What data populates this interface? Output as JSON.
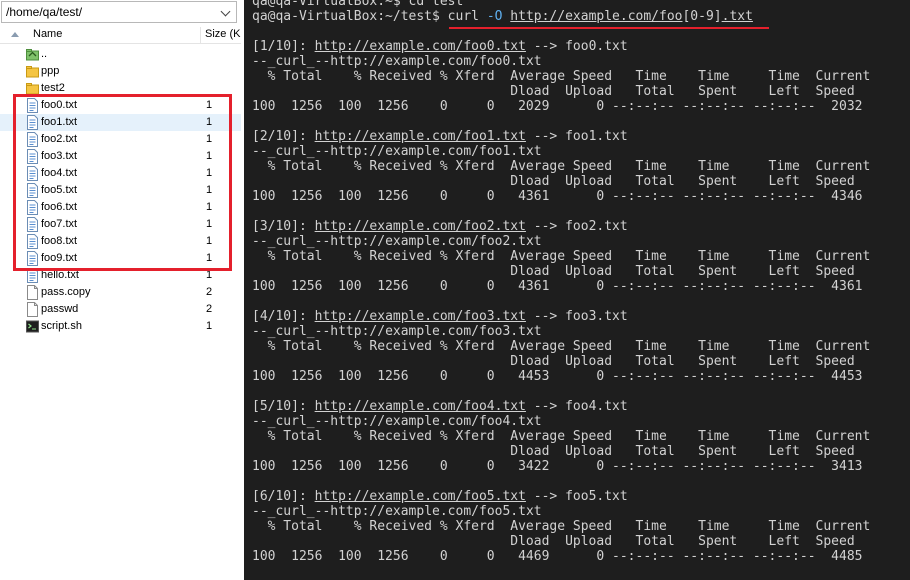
{
  "file_panel": {
    "path": "/home/qa/test/",
    "columns": {
      "name": "Name",
      "size": "Size (K"
    },
    "files": [
      {
        "name": "..",
        "size": "",
        "icon": "folder-up-icon"
      },
      {
        "name": "ppp",
        "size": "",
        "icon": "folder-icon"
      },
      {
        "name": "test2",
        "size": "",
        "icon": "folder-icon"
      },
      {
        "name": "foo0.txt",
        "size": "1",
        "icon": "text-file-icon"
      },
      {
        "name": "foo1.txt",
        "size": "1",
        "icon": "text-file-icon"
      },
      {
        "name": "foo2.txt",
        "size": "1",
        "icon": "text-file-icon"
      },
      {
        "name": "foo3.txt",
        "size": "1",
        "icon": "text-file-icon"
      },
      {
        "name": "foo4.txt",
        "size": "1",
        "icon": "text-file-icon"
      },
      {
        "name": "foo5.txt",
        "size": "1",
        "icon": "text-file-icon"
      },
      {
        "name": "foo6.txt",
        "size": "1",
        "icon": "text-file-icon"
      },
      {
        "name": "foo7.txt",
        "size": "1",
        "icon": "text-file-icon"
      },
      {
        "name": "foo8.txt",
        "size": "1",
        "icon": "text-file-icon"
      },
      {
        "name": "foo9.txt",
        "size": "1",
        "icon": "text-file-icon"
      },
      {
        "name": "hello.txt",
        "size": "1",
        "icon": "text-file-icon"
      },
      {
        "name": "pass.copy",
        "size": "2",
        "icon": "file-icon"
      },
      {
        "name": "passwd",
        "size": "2",
        "icon": "file-icon"
      },
      {
        "name": "script.sh",
        "size": "1",
        "icon": "shell-script-icon"
      }
    ],
    "selected_index": 4
  },
  "terminal": {
    "prev_line": "qa@qa-VirtualBox:~$ cd test",
    "prompt": "qa@qa-VirtualBox:~/test$ ",
    "cmd": {
      "name": "curl",
      "flag": "-O",
      "url_base": "http://example.com/foo",
      "glob": "[0-9]",
      "ext": ".txt"
    },
    "header1": "  % Total    % Received % Xferd  Average Speed   Time    Time     Time  Current",
    "header2": "                                 Dload  Upload   Total   Spent    Left  Speed",
    "arrow": " --> ",
    "curl_prefix": "--_curl_--",
    "blocks": [
      {
        "tag": "[1/10]: ",
        "url": "http://example.com/foo0.txt",
        "out": "foo0.txt",
        "stats": "100  1256  100  1256    0     0   2029      0 --:--:-- --:--:-- --:--:--  2032"
      },
      {
        "tag": "[2/10]: ",
        "url": "http://example.com/foo1.txt",
        "out": "foo1.txt",
        "stats": "100  1256  100  1256    0     0   4361      0 --:--:-- --:--:-- --:--:--  4346"
      },
      {
        "tag": "[3/10]: ",
        "url": "http://example.com/foo2.txt",
        "out": "foo2.txt",
        "stats": "100  1256  100  1256    0     0   4361      0 --:--:-- --:--:-- --:--:--  4361"
      },
      {
        "tag": "[4/10]: ",
        "url": "http://example.com/foo3.txt",
        "out": "foo3.txt",
        "stats": "100  1256  100  1256    0     0   4453      0 --:--:-- --:--:-- --:--:--  4453"
      },
      {
        "tag": "[5/10]: ",
        "url": "http://example.com/foo4.txt",
        "out": "foo4.txt",
        "stats": "100  1256  100  1256    0     0   3422      0 --:--:-- --:--:-- --:--:--  3413"
      },
      {
        "tag": "[6/10]: ",
        "url": "http://example.com/foo5.txt",
        "out": "foo5.txt",
        "stats": "100  1256  100  1256    0     0   4469      0 --:--:-- --:--:-- --:--:--  4485"
      }
    ]
  },
  "colors": {
    "terminal_bg": "#1e1e1e",
    "terminal_fg": "#d2d2d2",
    "flag_blue": "#5fb0f0",
    "highlight_red": "#e4202c",
    "selected_row": "#e5f1fb"
  }
}
